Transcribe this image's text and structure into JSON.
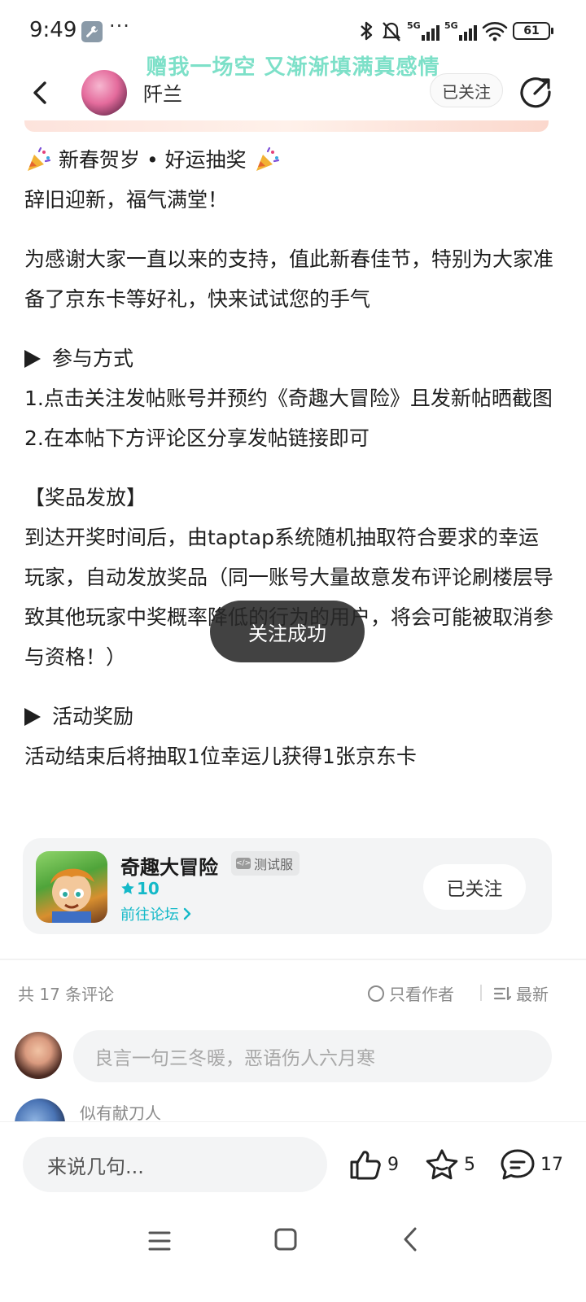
{
  "status_bar": {
    "time": "9:49",
    "dots": "···",
    "battery": "61",
    "signal_label": "5G"
  },
  "lyric": "赠我一场空 又渐渐填满真感情",
  "header": {
    "author_name": "阡兰",
    "follow_label": "已关注"
  },
  "article": {
    "title_line": "新春贺岁 • 好运抽奖",
    "greeting": "辞旧迎新，福气满堂！",
    "intro": "为感谢大家一直以来的支持，值此新春佳节，特别为大家准备了京东卡等好礼，快来试试您的手气",
    "how_title": "参与方式",
    "step1": "1.点击关注发帖账号并预约《奇趣大冒险》且发新帖晒截图",
    "step2": "2.在本帖下方评论区分享发帖链接即可",
    "prize_title": "【奖品发放】",
    "prize_text": "到达开奖时间后，由taptap系统随机抽取符合要求的幸运玩家，自动发放奖品（同一账号大量故意发布评论刷楼层导致其他玩家中奖概率降低的行为的用户，将会可能被取消参与资格！）",
    "reward_title": "活动奖励",
    "reward_text": "活动结束后将抽取1位幸运儿获得1张京东卡"
  },
  "toast": "关注成功",
  "game_card": {
    "title": "奇趣大冒险",
    "badge": "测试服",
    "score": "10",
    "forum_link": "前往论坛",
    "follow_label": "已关注"
  },
  "comments": {
    "count_label": "共 17 条评论",
    "only_author": "只看作者",
    "sort_label": "最新",
    "input_placeholder": "良言一句三冬暖，恶语伤人六月寒",
    "peek_user": "似有献刀人"
  },
  "bottom_bar": {
    "input_placeholder": "来说几句...",
    "likes": "9",
    "stars": "5",
    "comments": "17"
  },
  "colors": {
    "accent": "#14b9c8",
    "lyric": "#7de0c8",
    "toast_bg": "#282828"
  }
}
